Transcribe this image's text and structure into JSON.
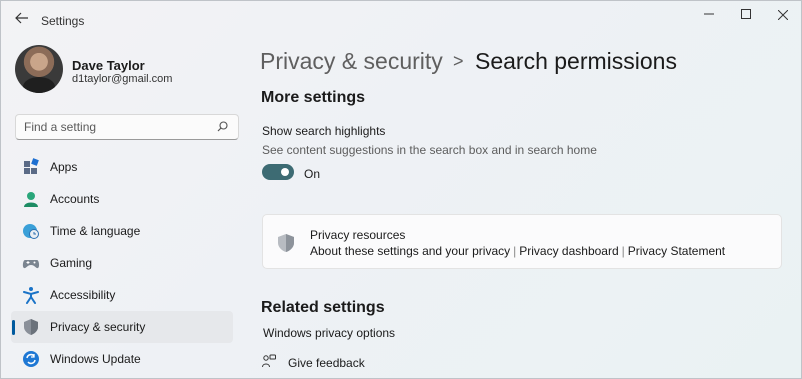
{
  "window": {
    "title": "Settings",
    "back_icon": "arrow-left-icon",
    "controls": [
      "minimize-icon",
      "maximize-icon",
      "close-icon"
    ]
  },
  "user": {
    "name": "Dave Taylor",
    "email": "d1taylor@gmail.com"
  },
  "search": {
    "placeholder": "Find a setting",
    "value": ""
  },
  "sidebar": {
    "items": [
      {
        "label": "Apps",
        "icon": "apps-icon"
      },
      {
        "label": "Accounts",
        "icon": "accounts-icon"
      },
      {
        "label": "Time & language",
        "icon": "globe-clock-icon"
      },
      {
        "label": "Gaming",
        "icon": "gamepad-icon"
      },
      {
        "label": "Accessibility",
        "icon": "accessibility-icon"
      },
      {
        "label": "Privacy & security",
        "icon": "shield-icon",
        "active": true
      },
      {
        "label": "Windows Update",
        "icon": "sync-icon"
      }
    ]
  },
  "breadcrumb": {
    "parent": "Privacy & security",
    "separator": ">",
    "current": "Search permissions"
  },
  "more_settings": {
    "title": "More settings",
    "option_label": "Show search highlights",
    "option_description": "See content suggestions in the search box and in search home",
    "toggle_state": "On"
  },
  "privacy_card": {
    "title": "Privacy resources",
    "links": [
      "About these settings and your privacy",
      "Privacy dashboard",
      "Privacy Statement"
    ],
    "link_separator": "|"
  },
  "related": {
    "title": "Related settings",
    "item": "Windows privacy options",
    "feedback": "Give feedback"
  },
  "colors": {
    "accent": "#005a9e",
    "toggle_on": "#3d6b73"
  }
}
